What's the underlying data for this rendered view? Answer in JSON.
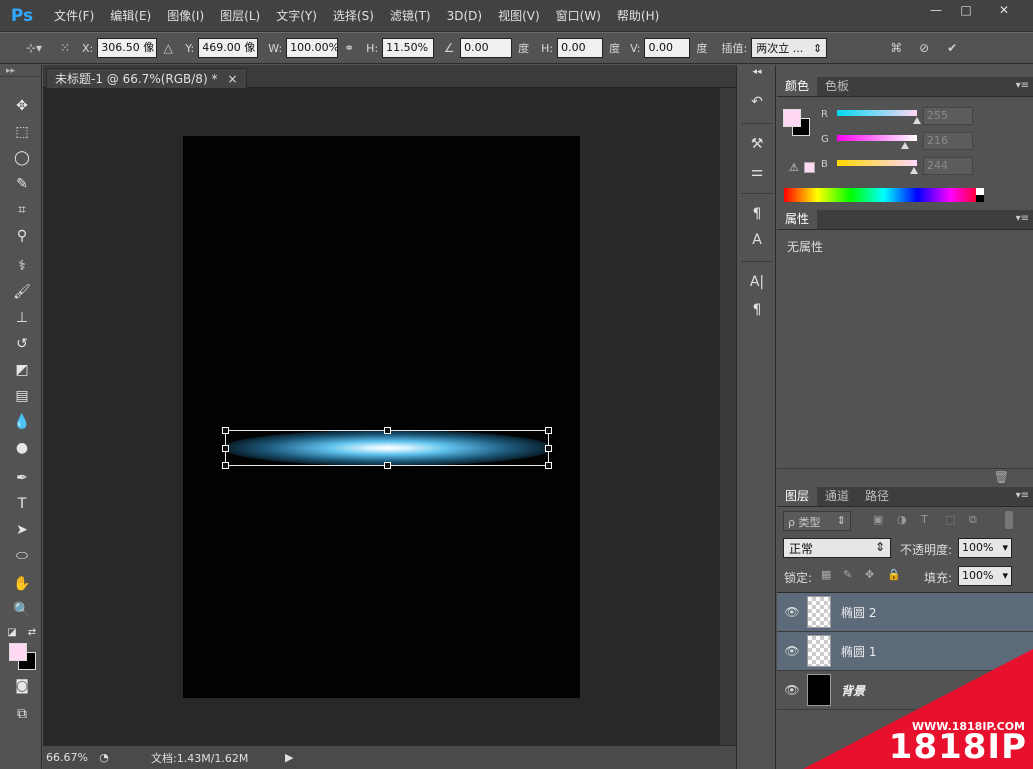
{
  "app": {
    "logo": "Ps"
  },
  "menu": [
    "文件(F)",
    "编辑(E)",
    "图像(I)",
    "图层(L)",
    "文字(Y)",
    "选择(S)",
    "滤镜(T)",
    "3D(D)",
    "视图(V)",
    "窗口(W)",
    "帮助(H)"
  ],
  "window_controls": {
    "minimize": "—",
    "maximize": "□",
    "close": "✕"
  },
  "options": {
    "x_label": "X:",
    "x_value": "306.50 像",
    "y_label": "Y:",
    "y_value": "469.00 像",
    "w_label": "W:",
    "w_value": "100.00%",
    "h_label": "H:",
    "h_value": "11.50%",
    "angle_value": "0.00",
    "angle_unit": "度",
    "hskew_label": "H:",
    "hskew_value": "0.00",
    "hskew_unit": "度",
    "vskew_label": "V:",
    "vskew_value": "0.00",
    "vskew_unit": "度",
    "interp_label": "插值:",
    "interp_value": "两次立 ..."
  },
  "document": {
    "tab_title": "未标题-1 @ 66.7%(RGB/8) *",
    "tab_close": "×",
    "zoom": "66.67%",
    "doc_info": "文档:1.43M/1.62M"
  },
  "colors": {
    "foreground": "#ffd8f4",
    "background": "#000000",
    "glow": "#5fc2ee"
  },
  "color_panel": {
    "tabs": [
      "颜色",
      "色板"
    ],
    "r_label": "R",
    "r_value": "255",
    "g_label": "G",
    "g_value": "216",
    "b_label": "B",
    "b_value": "244",
    "r_fraction": 1.0,
    "g_fraction": 0.847,
    "b_fraction": 0.957
  },
  "properties_panel": {
    "tab": "属性",
    "empty_text": "无属性"
  },
  "layers_panel": {
    "tabs": [
      "图层",
      "通道",
      "路径"
    ],
    "filter_label": "ρ 类型",
    "blend_mode": "正常",
    "opacity_label": "不透明度:",
    "opacity_value": "100%",
    "lock_label": "锁定:",
    "fill_label": "填充:",
    "fill_value": "100%",
    "layers": [
      {
        "name": "椭圆 2",
        "selected": true
      },
      {
        "name": "椭圆 1",
        "selected": true
      },
      {
        "name": "背景",
        "selected": false
      }
    ]
  },
  "watermark": {
    "url": "WWW.1818IP.COM",
    "brand": "1818IP"
  }
}
